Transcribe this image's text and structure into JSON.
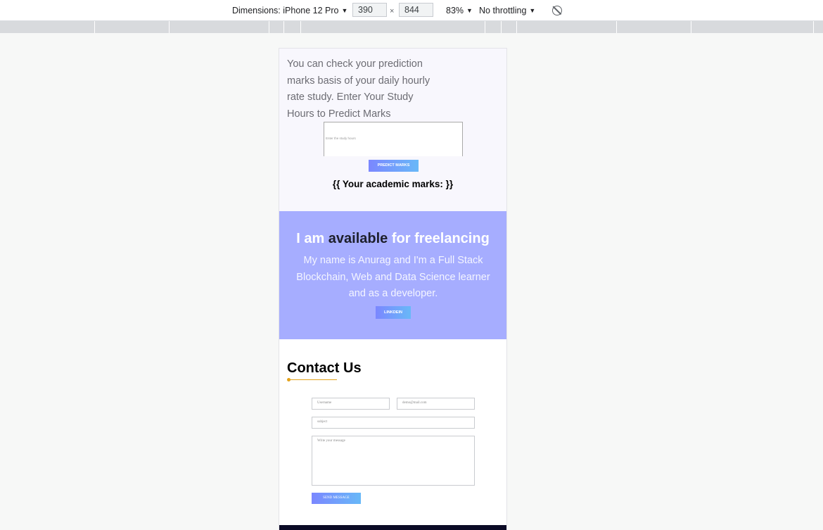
{
  "devtools": {
    "dimensions_label": "Dimensions: iPhone 12 Pro",
    "width": "390",
    "height": "844",
    "times": "×",
    "zoom": "83%",
    "throttling": "No throttling",
    "caret": "▼",
    "rotate_icon": "rotate-icon"
  },
  "predict": {
    "description": "You can check your prediction marks basis of your daily hourly rate study. Enter Your Study Hours to Predict Marks",
    "input_placeholder": "Enter the study hours",
    "button_label": "PREDICT MARKS",
    "result": "{{ Your academic marks: }}"
  },
  "freelance": {
    "title_prefix": "I am",
    "title_highlight": "available",
    "title_suffix": "for freelancing",
    "description": "My name is Anurag and I'm a Full Stack Blockchain, Web and Data Science learner and as a developer.",
    "button_label": "LINKDEIN"
  },
  "contact": {
    "title": "Contact Us",
    "name_placeholder": "Username",
    "email_placeholder": "demo@mail.com",
    "subject_placeholder": "subject",
    "message_placeholder": "Write your message",
    "send_label": "SEND MESSAGE"
  },
  "colors": {
    "freelance_bg": "#a6adff",
    "button_gradient_start": "#7b87ff",
    "button_gradient_end": "#68b8f8",
    "accent_line": "#e3a21a",
    "footer": "#0b0b26"
  }
}
